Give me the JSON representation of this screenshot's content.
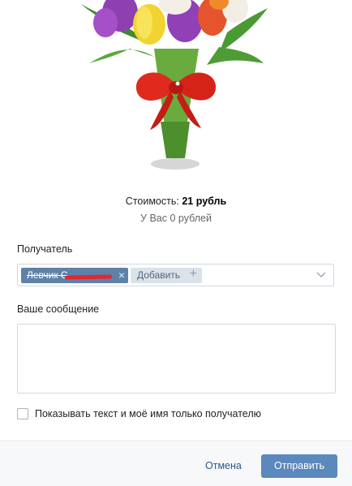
{
  "gift": {
    "image": "tulip-bouquet-image",
    "price_label": "Стоимость:",
    "price_value": "21 рубль",
    "balance": "У Вас 0 рублей"
  },
  "recipient": {
    "label": "Получатель",
    "tag_name": "Левчик С",
    "remove_icon": "close-icon",
    "add_label": "Добавить",
    "add_icon": "plus-icon",
    "dropdown_icon": "chevron-down-icon"
  },
  "message": {
    "label": "Ваше сообщение",
    "value": ""
  },
  "privacy": {
    "checked": false,
    "label": "Показывать текст и моё имя только получателю"
  },
  "footer": {
    "cancel_label": "Отмена",
    "send_label": "Отправить"
  },
  "colors": {
    "tag_bg": "#5e81a8",
    "add_bg": "#dae2ea",
    "link": "#2a5885",
    "primary_button": "#5b88bd",
    "redaction": "#e6262e"
  }
}
